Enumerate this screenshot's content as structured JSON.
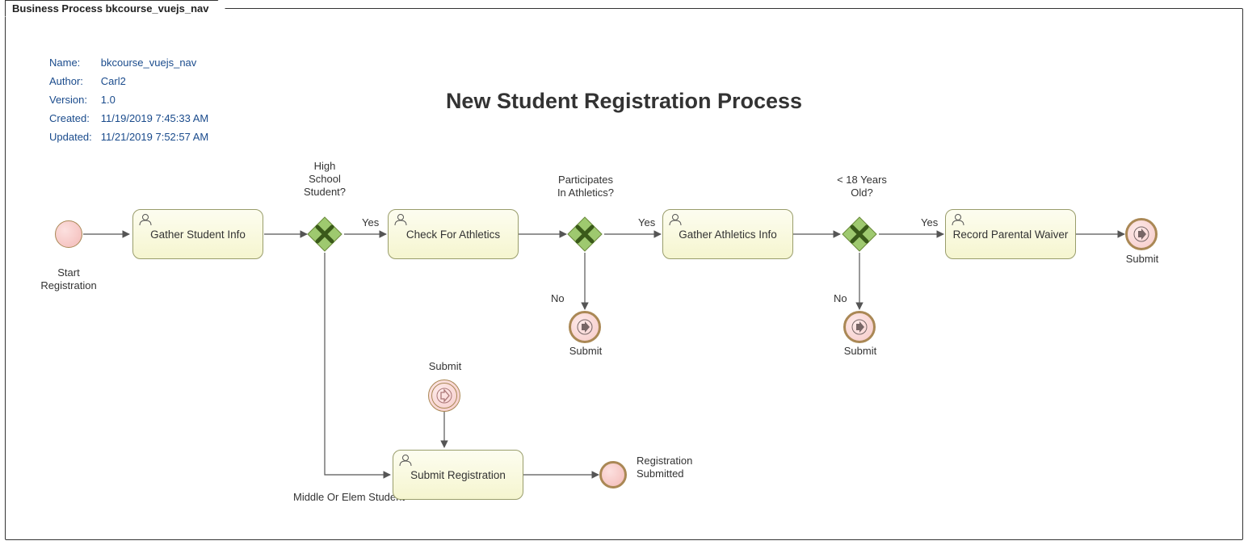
{
  "frame_title": "Business Process bkcourse_vuejs_nav",
  "meta": {
    "name_label": "Name:",
    "name_value": "bkcourse_vuejs_nav",
    "author_label": "Author:",
    "author_value": "Carl2",
    "version_label": "Version:",
    "version_value": "1.0",
    "created_label": "Created:",
    "created_value": "11/19/2019 7:45:33 AM",
    "updated_label": "Updated:",
    "updated_value": "11/21/2019 7:52:57 AM"
  },
  "diagram_title": "New Student Registration Process",
  "tasks": {
    "gather_student": "Gather Student Info",
    "check_athletics": "Check For Athletics",
    "gather_athletics": "Gather Athletics Info",
    "record_waiver": "Record Parental Waiver",
    "submit_reg": "Submit Registration"
  },
  "events": {
    "start_label": "Start\nRegistration",
    "submit": "Submit",
    "reg_submitted": "Registration\nSubmitted"
  },
  "gateways": {
    "hs": "High\nSchool\nStudent?",
    "athletics": "Participates\nIn Athletics?",
    "age": "< 18 Years\nOld?"
  },
  "flow_labels": {
    "yes": "Yes",
    "no": "No",
    "middle_elem": "Middle Or Elem Student"
  }
}
